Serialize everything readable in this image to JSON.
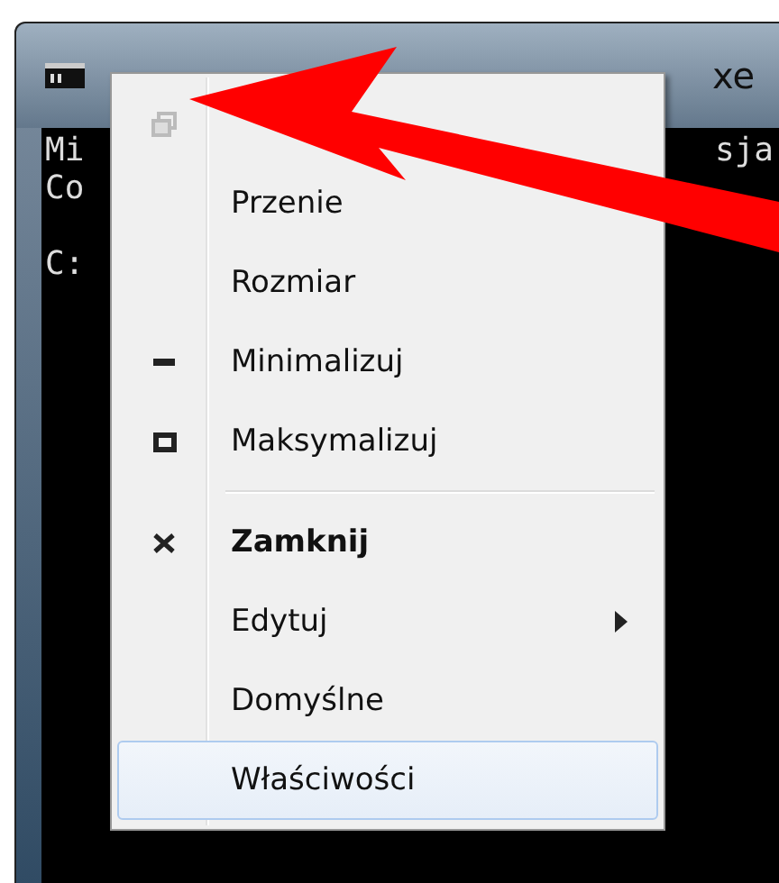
{
  "window": {
    "title": "xe"
  },
  "console": {
    "lines": [
      {
        "left": "Mi",
        "right": "sja"
      },
      {
        "left": "Co"
      },
      {
        "left": "C:"
      }
    ]
  },
  "menu": {
    "items": [
      {
        "kind": "restore",
        "disabled": true
      },
      {
        "label": "Przenie",
        "kind": "plain",
        "disabled": false,
        "bold": false,
        "submenu": false,
        "selected": false
      },
      {
        "label": "Rozmiar",
        "kind": "plain",
        "disabled": false,
        "bold": false,
        "submenu": false,
        "selected": false
      },
      {
        "label": "Minimalizuj",
        "kind": "minimize",
        "disabled": false,
        "bold": false,
        "submenu": false,
        "selected": false
      },
      {
        "label": "Maksymalizuj",
        "kind": "maximize",
        "disabled": false,
        "bold": false,
        "submenu": false,
        "selected": false,
        "separator_after": true
      },
      {
        "label": "Zamknij",
        "kind": "close",
        "disabled": false,
        "bold": true,
        "submenu": false,
        "selected": false
      },
      {
        "label": "Edytuj",
        "kind": "plain",
        "disabled": false,
        "bold": false,
        "submenu": true,
        "selected": false
      },
      {
        "label": "Domyślne",
        "kind": "plain",
        "disabled": false,
        "bold": false,
        "submenu": false,
        "selected": false
      },
      {
        "label": "Właściwości",
        "kind": "plain",
        "disabled": false,
        "bold": false,
        "submenu": false,
        "selected": true
      }
    ]
  }
}
